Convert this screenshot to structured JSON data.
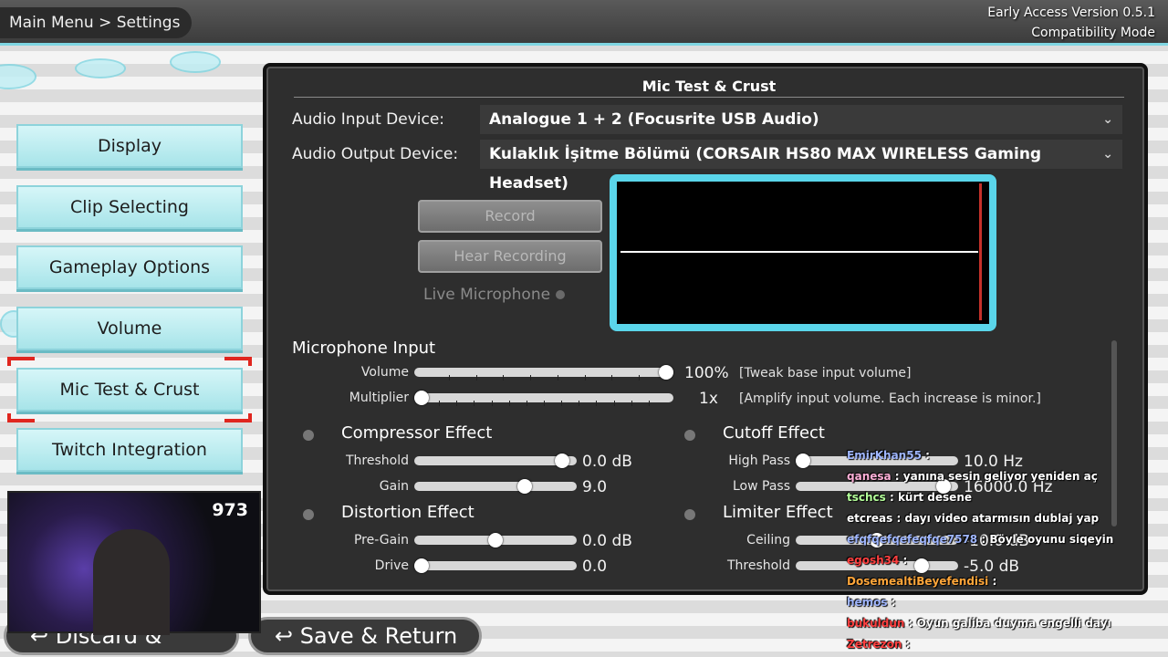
{
  "header": {
    "breadcrumb": "Main Menu > Settings",
    "version": "Early Access Version 0.5.1",
    "mode": "Compatibility Mode"
  },
  "sidebar": {
    "items": [
      {
        "label": "Display"
      },
      {
        "label": "Clip Selecting"
      },
      {
        "label": "Gameplay Options"
      },
      {
        "label": "Volume"
      },
      {
        "label": "Mic Test & Crust",
        "selected": true
      },
      {
        "label": "Twitch Integration"
      }
    ]
  },
  "panel": {
    "title": "Mic Test & Crust",
    "input_label": "Audio Input Device:",
    "input_value": "Analogue 1 + 2 (Focusrite USB Audio)",
    "output_label": "Audio Output Device:",
    "output_value": "Kulaklık İşitme Bölümü (CORSAIR HS80 MAX WIRELESS Gaming Headset)",
    "record_label": "Record",
    "hear_label": "Hear Recording",
    "live_label": "Live Microphone",
    "mic_input": {
      "heading": "Microphone Input",
      "volume_label": "Volume",
      "volume_value": "100%",
      "volume_note": "[Tweak base input volume]",
      "volume_level": 1.0,
      "multiplier_label": "Multiplier",
      "multiplier_value": "1x",
      "multiplier_note": "[Amplify input volume. Each increase is minor.]",
      "multiplier_level": 0.0
    },
    "compressor": {
      "heading": "Compressor Effect",
      "threshold_label": "Threshold",
      "threshold_value": "0.0 dB",
      "threshold_level": 0.95,
      "gain_label": "Gain",
      "gain_value": "9.0",
      "gain_level": 0.7
    },
    "distortion": {
      "heading": "Distortion Effect",
      "pregain_label": "Pre-Gain",
      "pregain_value": "0.0 dB",
      "pregain_level": 0.5,
      "drive_label": "Drive",
      "drive_value": "0.0",
      "drive_level": 0.0
    },
    "cutoff": {
      "heading": "Cutoff Effect",
      "highpass_label": "High Pass",
      "highpass_value": "10.0 Hz",
      "highpass_level": 0.0,
      "lowpass_label": "Low Pass",
      "lowpass_value": "16000.0 Hz",
      "lowpass_level": 0.95
    },
    "limiter": {
      "heading": "Limiter Effect",
      "ceiling_label": "Ceiling",
      "ceiling_value": "-10.0 dB",
      "ceiling_level": 0.5,
      "threshold_label": "Threshold",
      "threshold_value": "-5.0 dB",
      "threshold_level": 0.8
    }
  },
  "bottom": {
    "discard_label": "↩ Discard & Return",
    "save_label": "↩ Save & Return"
  },
  "overlay": {
    "viewer_count": "973",
    "chat": [
      {
        "user": "EmirKhan55",
        "text": ""
      },
      {
        "user": "qanesa",
        "text": "yanına sesin geliyor yeniden aç"
      },
      {
        "user": "tschcs",
        "text": "kürt desene"
      },
      {
        "user": "etcreas",
        "text": "dayı video atarmısın dublaj yap"
      },
      {
        "user": "efqfqefqefeqfqe7578",
        "text": "Böyle oyunu siqeyin"
      },
      {
        "user": "egosh34",
        "text": ""
      },
      {
        "user": "DosemealtiBeyefendisi",
        "text": ""
      },
      {
        "user": "hemos",
        "text": ""
      },
      {
        "user": "bukuldun",
        "text": "Oyun galiba duyma engelli dayı"
      },
      {
        "user": "Zetrezon",
        "text": ""
      }
    ]
  }
}
